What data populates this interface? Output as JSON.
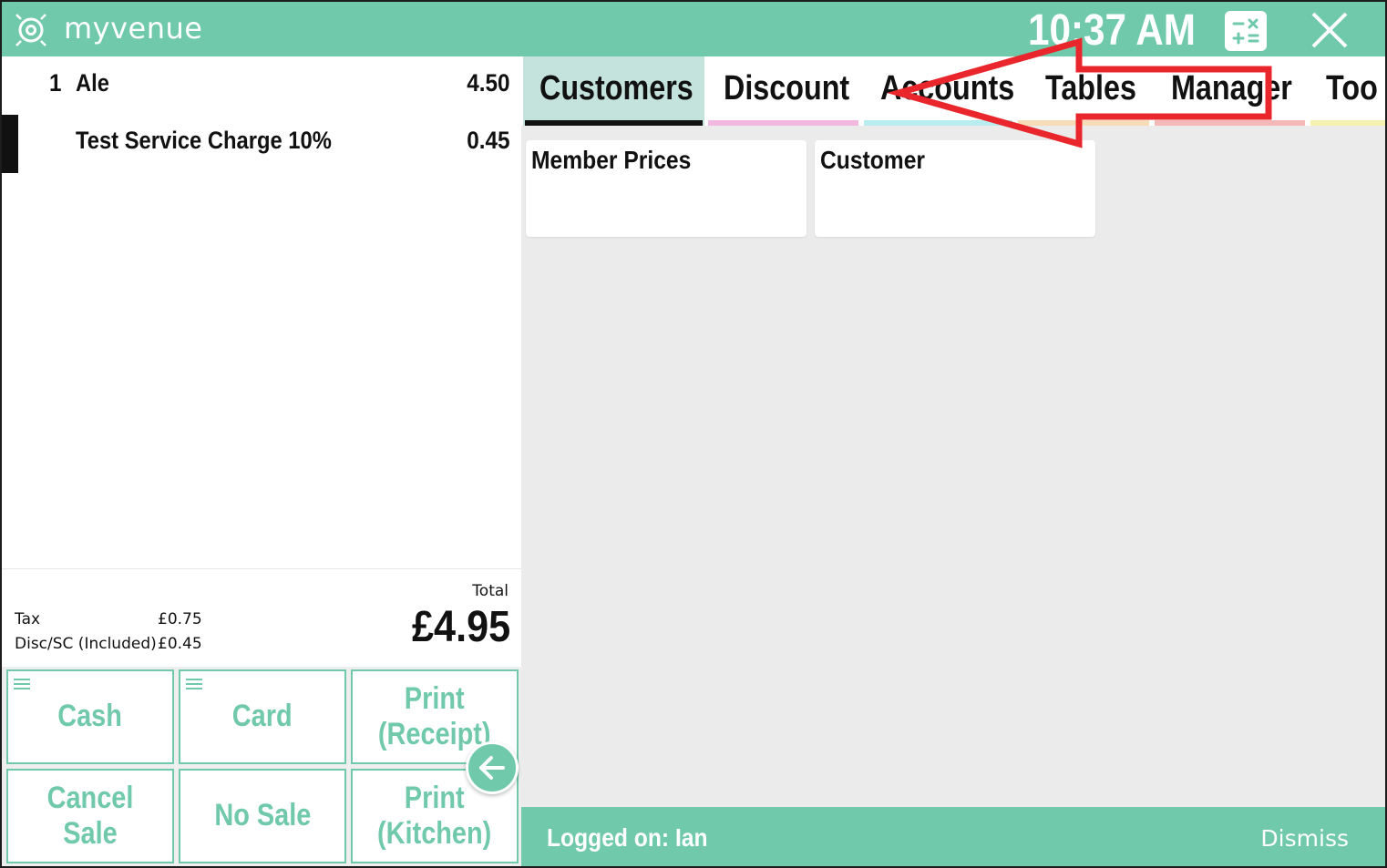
{
  "header": {
    "brand": "myvenue",
    "time": "10:37 AM"
  },
  "order": {
    "items": [
      {
        "qty": "1",
        "name": "Ale",
        "price": "4.50"
      },
      {
        "qty": "",
        "name": "Test Service Charge 10%",
        "price": "0.45"
      }
    ]
  },
  "totals": {
    "tax_label": "Tax",
    "tax_value": "£0.75",
    "disc_label": "Disc/SC (Included)",
    "disc_value": "£0.45",
    "total_label": "Total",
    "total_value": "£4.95"
  },
  "buttons": {
    "cash": "Cash",
    "card": "Card",
    "print_receipt_1": "Print",
    "print_receipt_2": "(Receipt)",
    "cancel_sale": "Cancel Sale",
    "no_sale": "No Sale",
    "print_kitchen_1": "Print",
    "print_kitchen_2": "(Kitchen)"
  },
  "tabs": [
    {
      "label": "Customers",
      "color": "#111111"
    },
    {
      "label": "Discount",
      "color": "#f2b8e0"
    },
    {
      "label": "Accounts",
      "color": "#b9ecef"
    },
    {
      "label": "Tables",
      "color": "#f7dcb8"
    },
    {
      "label": "Manager",
      "color": "#f4b8b8"
    },
    {
      "label": "Too",
      "color": "#f5f2b0"
    }
  ],
  "cards": [
    {
      "label": "Member Prices"
    },
    {
      "label": "Customer"
    }
  ],
  "status": {
    "logged_on": "Logged on: Ian",
    "dismiss": "Dismiss"
  },
  "colors": {
    "accent": "#6fc9aa",
    "active_tab_bg": "#c4e3dc",
    "annotation": "#e8262b"
  },
  "icons": [
    "myvenue-logo-icon",
    "calculator-icon",
    "close-icon",
    "menu-icon",
    "arrow-left-icon"
  ]
}
